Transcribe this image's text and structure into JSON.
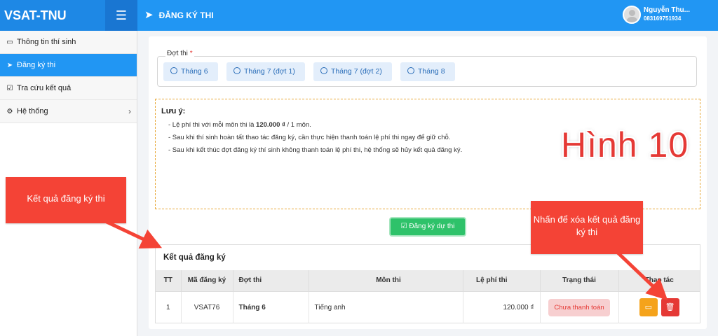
{
  "app": {
    "brand": "VSAT-TNU",
    "page_title": "ĐĂNG KÝ THI"
  },
  "user": {
    "name": "Nguyễn Thu...",
    "phone": "083169751934"
  },
  "sidebar": {
    "items": [
      {
        "label": "Thông tin thí sinh",
        "icon": "id-card-icon"
      },
      {
        "label": "Đăng ký thi",
        "icon": "paper-plane-icon",
        "active": true
      },
      {
        "label": "Tra cứu kết quả",
        "icon": "checkbox-icon"
      },
      {
        "label": "Hệ thống",
        "icon": "gears-icon"
      }
    ]
  },
  "exam_period": {
    "label": "Đợt thi",
    "required_mark": "*",
    "options": [
      "Tháng 6",
      "Tháng 7 (đợt 1)",
      "Tháng 7 (đợt 2)",
      "Tháng 8"
    ]
  },
  "note": {
    "title": "Lưu ý:",
    "line1_prefix": "- Lệ phí thi với mỗi môn thi là ",
    "line1_bold": "120.000 ₫",
    "line1_suffix": " / 1 môn.",
    "line2": "- Sau khi thí sinh hoàn tất thao tác đăng ký, cần thực hiện thanh toán lệ phí thi ngay để giữ chỗ.",
    "line3": "- Sau khi kết thúc đợt đăng ký thí sinh không thanh toán lệ phí thi, hệ thống sẽ hủy kết quả đăng ký."
  },
  "register_button": "Đăng ký dự thi",
  "results": {
    "title": "Kết quả đăng ký",
    "columns": [
      "TT",
      "Mã đăng ký",
      "Đợt thi",
      "Môn thi",
      "Lệ phí thi",
      "Trạng thái",
      "Thao tác"
    ],
    "rows": [
      {
        "tt": "1",
        "code": "VSAT76",
        "period": "Tháng 6",
        "subject": "Tiếng anh",
        "fee": "120.000 ₫",
        "status": "Chưa thanh toán"
      }
    ]
  },
  "annotations": {
    "label": "Hình 10",
    "callout_left": "Kết quả đăng ký thi",
    "callout_right": "Nhấn để xóa  kết quả đăng ký thi"
  },
  "colors": {
    "primary": "#2196f3",
    "success": "#2ec26a",
    "danger": "#e53935",
    "warning": "#f5a31b",
    "callout": "#f44336"
  }
}
